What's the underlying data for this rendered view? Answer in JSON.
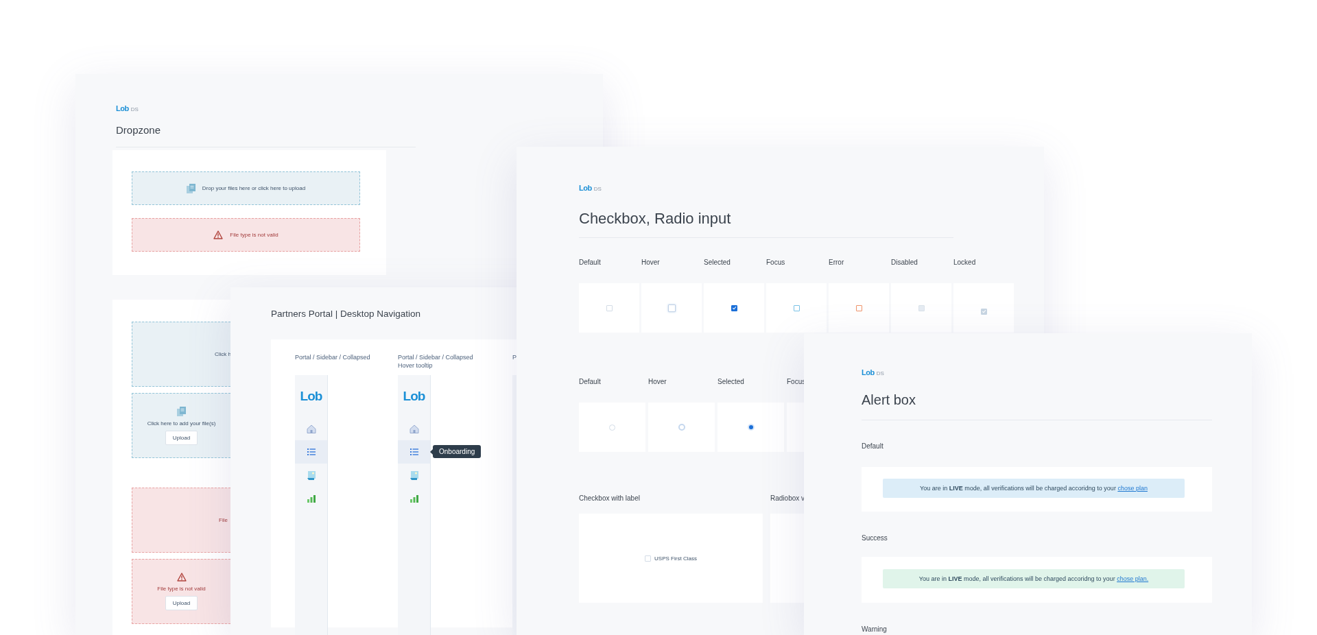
{
  "dropzone_card": {
    "brand": "Lob",
    "brand_suffix": "DS",
    "title": "Dropzone",
    "panels": [
      {
        "zones": [
          {
            "kind": "info",
            "text": "Drop your files here or click here to upload"
          },
          {
            "kind": "error",
            "text": "File type is not valid"
          }
        ]
      },
      {
        "zones": [
          {
            "kind": "info",
            "text": "Click h"
          },
          {
            "kind": "info",
            "text": "Click here to add your file(s)",
            "button": "Upload"
          },
          {
            "kind": "error",
            "text": "File"
          },
          {
            "kind": "error",
            "text": "File type is not valid",
            "button": "Upload"
          }
        ]
      }
    ]
  },
  "navigation_card": {
    "title": "Partners Portal | Desktop Navigation",
    "columns": [
      {
        "label": "Portal / Sidebar / Collapsed",
        "brand": "Lob",
        "items": [
          {
            "kind": "home",
            "selected": false
          },
          {
            "kind": "list",
            "selected": true
          },
          {
            "kind": "image",
            "selected": false
          },
          {
            "kind": "chart",
            "selected": false
          }
        ]
      },
      {
        "label": "Portal / Sidebar / Collapsed Hover tooltip",
        "brand": "Lob",
        "tooltip": "Onboarding",
        "items": [
          {
            "kind": "home",
            "selected": false
          },
          {
            "kind": "list",
            "selected": true
          },
          {
            "kind": "image",
            "selected": false
          },
          {
            "kind": "chart",
            "selected": false
          }
        ]
      },
      {
        "label": "P"
      }
    ]
  },
  "checkbox_card": {
    "brand": "Lob",
    "brand_suffix": "DS",
    "title": "Checkbox, Radio input",
    "checkboxes": [
      {
        "label": "Default",
        "kind": "default",
        "checked": false
      },
      {
        "label": "Hover",
        "kind": "hover",
        "checked": false
      },
      {
        "label": "Selected",
        "kind": "selected",
        "checked": true
      },
      {
        "label": "Focus",
        "kind": "focus",
        "checked": false
      },
      {
        "label": "Error",
        "kind": "error",
        "checked": false
      },
      {
        "label": "Disabled",
        "kind": "disabled",
        "checked": false
      },
      {
        "label": "Locked",
        "kind": "locked",
        "checked": true
      }
    ],
    "radios": [
      {
        "label": "Default",
        "kind": "default",
        "selected": false
      },
      {
        "label": "Hover",
        "kind": "hover",
        "selected": false
      },
      {
        "label": "Selected",
        "kind": "selected",
        "selected": true
      },
      {
        "label": "Focus"
      }
    ],
    "labeled_sections": [
      {
        "label": "Checkbox with label",
        "option": {
          "text": "USPS First Class",
          "checked": false
        }
      },
      {
        "label": "Radiobox v"
      }
    ]
  },
  "alert_card": {
    "brand": "Lob",
    "brand_suffix": "DS",
    "title": "Alert box",
    "sections": [
      {
        "label": "Default",
        "kind": "default",
        "text": "You are in **LIVE** mode, all verifications will be charged accoridng to your",
        "link": "chose plan"
      },
      {
        "label": "Success",
        "kind": "success",
        "text": "You are in **LIVE** mode, all verifications will be charged accoridng to your",
        "link": "chose plan."
      },
      {
        "label": "Warning"
      }
    ]
  }
}
